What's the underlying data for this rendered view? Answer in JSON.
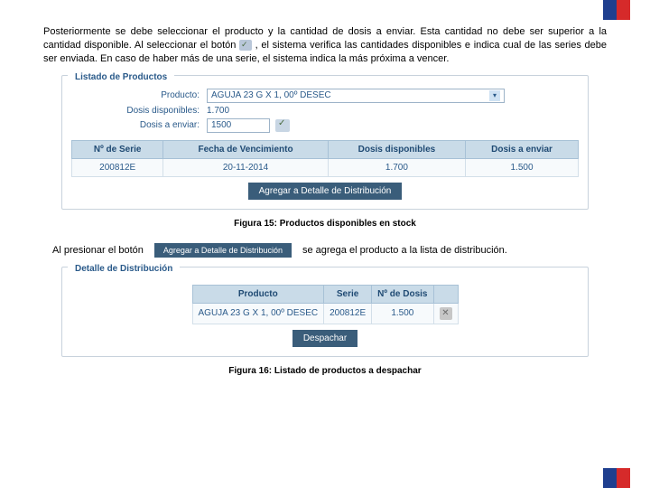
{
  "flag": {
    "colors": [
      "#1f3f8f",
      "#d62a2a"
    ]
  },
  "intro": {
    "p1a": "Posteriormente se debe seleccionar el producto y la cantidad de dosis a enviar. Esta cantidad no debe ser superior a la cantidad disponible. Al seleccionar el botón ",
    "p1b": " , el sistema verifica las cantidades disponibles e indica cual de las series debe ser enviada. En caso de haber más de una serie, el sistema indica la más próxima a vencer."
  },
  "panel1": {
    "title": "Listado de Productos",
    "rows": {
      "producto_label": "Producto:",
      "producto_value": "AGUJA 23 G X 1, 00º DESEC",
      "disponibles_label": "Dosis disponibles:",
      "disponibles_value": "1.700",
      "enviar_label": "Dosis a enviar:",
      "enviar_value": "1500"
    },
    "grid": {
      "headers": {
        "c1": "Nº de Serie",
        "c2": "Fecha de Vencimiento",
        "c3": "Dosis disponibles",
        "c4": "Dosis a enviar"
      },
      "row": {
        "c1": "200812E",
        "c2": "20-11-2014",
        "c3": "1.700",
        "c4": "1.500"
      }
    },
    "button": "Agregar a Detalle de Distribución"
  },
  "caption1": "Figura 15: Productos disponibles en stock",
  "midline": {
    "left": "Al presionar el botón",
    "button": "Agregar a Detalle de Distribución",
    "right": "se agrega el producto a la lista de distribución."
  },
  "panel2": {
    "title": "Detalle de Distribución",
    "grid": {
      "headers": {
        "c1": "Producto",
        "c2": "Serie",
        "c3": "Nº de Dosis",
        "c4": ""
      },
      "row": {
        "c1": "AGUJA 23 G X 1, 00º DESEC",
        "c2": "200812E",
        "c3": "1.500"
      }
    },
    "button": "Despachar"
  },
  "caption2": "Figura 16: Listado de productos a despachar"
}
